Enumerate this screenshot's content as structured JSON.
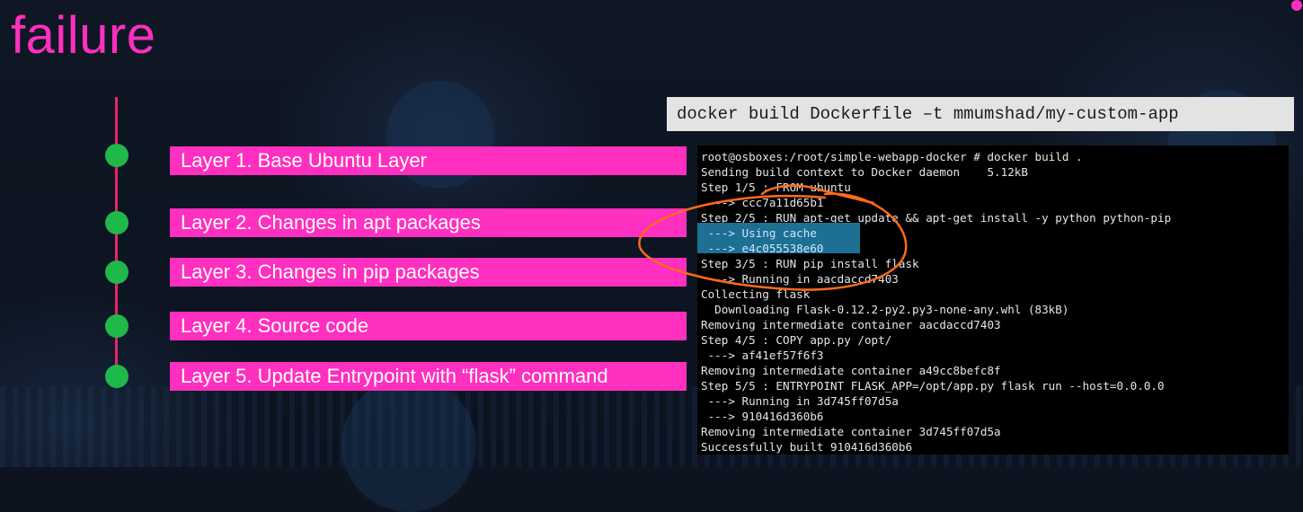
{
  "slide": {
    "title": "failure"
  },
  "layers": [
    {
      "label": "Layer 1. Base Ubuntu Layer"
    },
    {
      "label": "Layer 2. Changes in apt packages"
    },
    {
      "label": "Layer 3. Changes in pip packages"
    },
    {
      "label": "Layer 4. Source code"
    },
    {
      "label": "Layer 5. Update Entrypoint with “flask” command"
    }
  ],
  "command": {
    "text": "docker build Dockerfile –t mmumshad/my-custom-app"
  },
  "terminal": {
    "lines": [
      "root@osboxes:/root/simple-webapp-docker # docker build .",
      "Sending build context to Docker daemon    5.12kB",
      "Step 1/5 : FROM ubuntu",
      " ---> ccc7a11d65b1",
      "Step 2/5 : RUN apt-get update && apt-get install -y python python-pip",
      " ---> Using cache",
      " ---> e4c055538e60",
      "Step 3/5 : RUN pip install flask",
      " ---> Running in aacdaccd7403",
      "Collecting flask",
      "  Downloading Flask-0.12.2-py2.py3-none-any.whl (83kB)",
      "Removing intermediate container aacdaccd7403",
      "Step 4/5 : COPY app.py /opt/",
      " ---> af41ef57f6f3",
      "Removing intermediate container a49cc8befc8f",
      "Step 5/5 : ENTRYPOINT FLASK_APP=/opt/app.py flask run --host=0.0.0.0",
      " ---> Running in 3d745ff07d5a",
      " ---> 910416d360b6",
      "Removing intermediate container 3d745ff07d5a",
      "Successfully built 910416d360b6"
    ]
  },
  "colors": {
    "accent": "#ff2fbf",
    "timeline": "#e8246d",
    "node": "#1fb84a",
    "annotation": "#ff6a1a",
    "cache_highlight": "#1d6f93"
  }
}
